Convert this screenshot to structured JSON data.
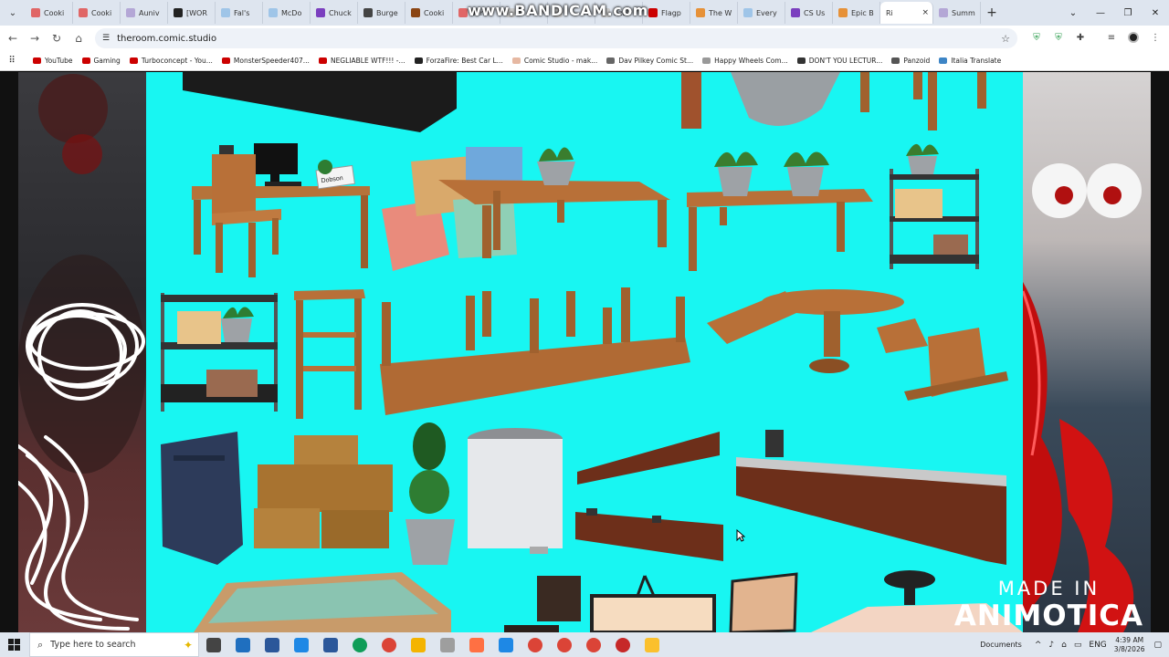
{
  "browser": {
    "tabs": [
      {
        "label": "Cooki",
        "color": "#e06666"
      },
      {
        "label": "Cooki",
        "color": "#e06666"
      },
      {
        "label": "Auniv",
        "color": "#b4a7d6"
      },
      {
        "label": "[WOR",
        "color": "#222222"
      },
      {
        "label": "Fal's",
        "color": "#9fc5e8"
      },
      {
        "label": "McDo",
        "color": "#9fc5e8"
      },
      {
        "label": "Chuck",
        "color": "#7b3fbf"
      },
      {
        "label": "Burge",
        "color": "#444444"
      },
      {
        "label": "Cooki",
        "color": "#8b4513"
      },
      {
        "label": "Vera",
        "color": "#e06666"
      },
      {
        "label": "",
        "color": "#cccccc"
      },
      {
        "label": "",
        "color": "#cccccc"
      },
      {
        "label": "nzo'",
        "color": "#cccccc"
      },
      {
        "label": "Flagp",
        "color": "#cc0000"
      },
      {
        "label": "The W",
        "color": "#e69138"
      },
      {
        "label": "Every",
        "color": "#9fc5e8"
      },
      {
        "label": "CS Us",
        "color": "#7b3fbf"
      },
      {
        "label": "Epic B",
        "color": "#e69138"
      }
    ],
    "active_tab": {
      "label": "Ri",
      "close": "×"
    },
    "after_tab": {
      "label": "Summ",
      "color": "#b4a7d6"
    },
    "new_tab": "+",
    "window_controls": [
      "⌄",
      "—",
      "❐",
      "✕"
    ],
    "url": "theroom.comic.studio",
    "nav": {
      "back": "←",
      "forward": "→",
      "reload": "↻",
      "home": "⌂"
    },
    "bookmarks": [
      {
        "label": "YouTube",
        "color": "#cc0000"
      },
      {
        "label": "Gaming",
        "color": "#cc0000"
      },
      {
        "label": "Turboconcept - You...",
        "color": "#cc0000"
      },
      {
        "label": "MonsterSpeeder407...",
        "color": "#cc0000"
      },
      {
        "label": "NEGLIABLE WTF!!! -...",
        "color": "#cc0000"
      },
      {
        "label": "ForzaFire: Best Car L...",
        "color": "#222222"
      },
      {
        "label": "Comic Studio - mak...",
        "color": "#e6b8a2"
      },
      {
        "label": "Dav Pilkey Comic St...",
        "color": "#666666"
      },
      {
        "label": "Happy Wheels Com...",
        "color": "#999999"
      },
      {
        "label": "DON'T YOU LECTUR...",
        "color": "#333333"
      },
      {
        "label": "Panzoid",
        "color": "#555555"
      },
      {
        "label": "Italia Translate",
        "color": "#3d85c6"
      }
    ]
  },
  "overlay": {
    "bandicam": "www.BANDICAM.com",
    "animotica_line1": "MADE IN",
    "animotica_line2": "ANIMOTICA"
  },
  "canvas": {
    "background": "#18f6f2",
    "name_plate": "Dobson"
  },
  "taskbar": {
    "search_placeholder": "Type here to search",
    "apps": [
      {
        "name": "task-view",
        "color": "#444444"
      },
      {
        "name": "app",
        "color": "#1f6fbf"
      },
      {
        "name": "app",
        "color": "#2b579a"
      },
      {
        "name": "app",
        "color": "#1e88e5"
      },
      {
        "name": "word",
        "color": "#2b579a"
      },
      {
        "name": "edge",
        "color": "#0f9d58"
      },
      {
        "name": "chrome",
        "color": "#db4437"
      },
      {
        "name": "files",
        "color": "#f4b400"
      },
      {
        "name": "app",
        "color": "#9e9e9e"
      },
      {
        "name": "app",
        "color": "#ff7043"
      },
      {
        "name": "app",
        "color": "#1e88e5"
      },
      {
        "name": "chrome",
        "color": "#db4437"
      },
      {
        "name": "chrome",
        "color": "#db4437"
      },
      {
        "name": "chrome",
        "color": "#db4437"
      },
      {
        "name": "record",
        "color": "#c62828"
      },
      {
        "name": "app",
        "color": "#fbc02d"
      }
    ],
    "tray_docs": "Documents",
    "lang": "ENG",
    "time": "4:39 AM",
    "date": "3/8/2026"
  }
}
